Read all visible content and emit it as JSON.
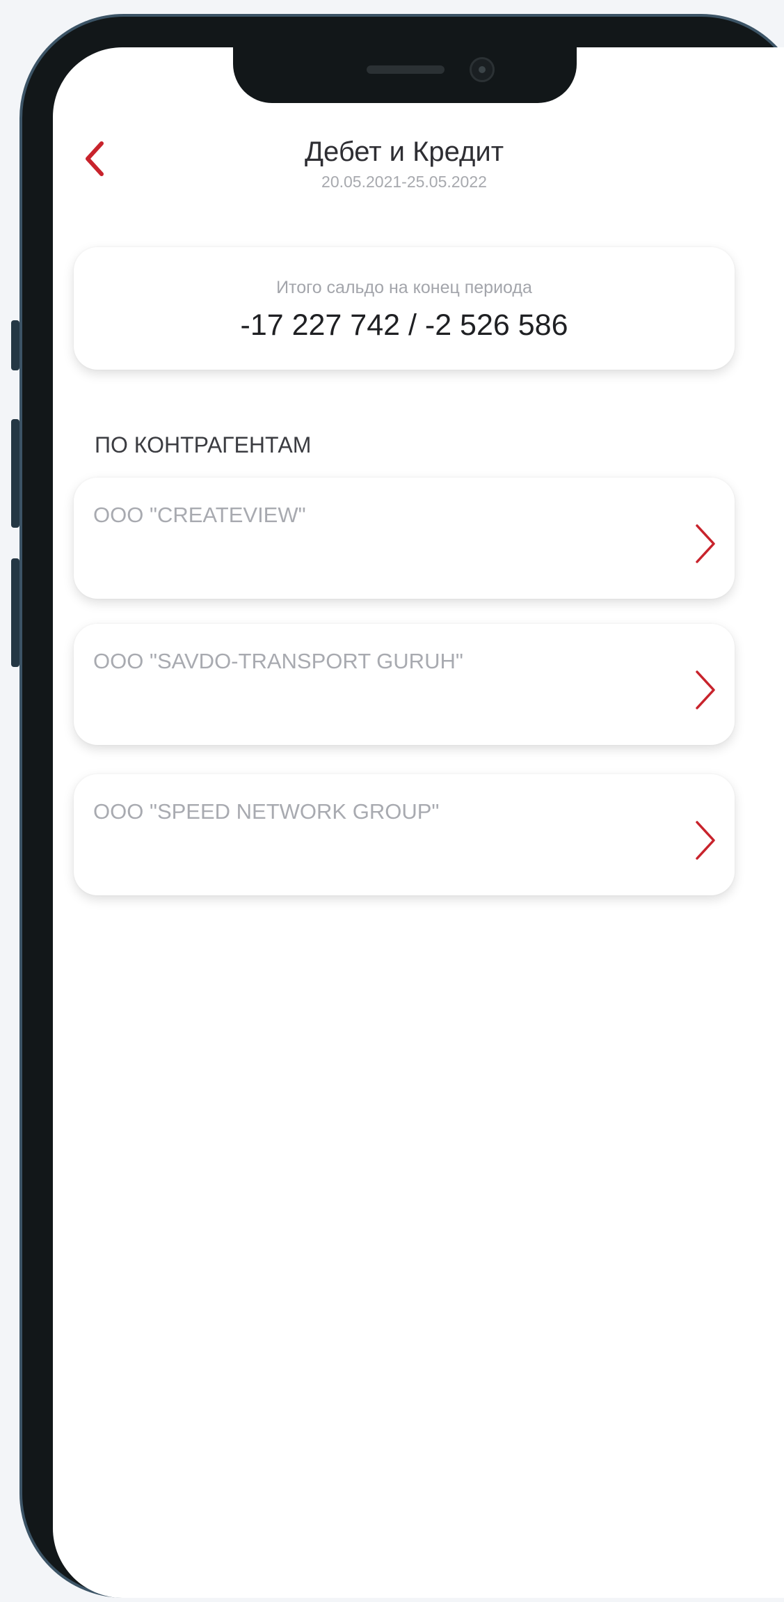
{
  "header": {
    "title": "Дебет и Кредит",
    "period": "20.05.2021-25.05.2022"
  },
  "summary": {
    "label": "Итого сальдо на конец периода",
    "value": "-17 227 742 / -2 526 586"
  },
  "section": {
    "heading": "ПО КОНТРАГЕНТАМ"
  },
  "counterparties": [
    {
      "name": "ООО \"CREATEVIEW\""
    },
    {
      "name": "ООО \"SAVDO-TRANSPORT GURUH\""
    },
    {
      "name": "ООО \"SPEED NETWORK GROUP\""
    }
  ],
  "colors": {
    "accent": "#c8232c",
    "frame": "#121719",
    "frame_edge": "#3c5466"
  },
  "icons": {
    "back": "chevron-left-icon",
    "row": "chevron-right-icon"
  }
}
